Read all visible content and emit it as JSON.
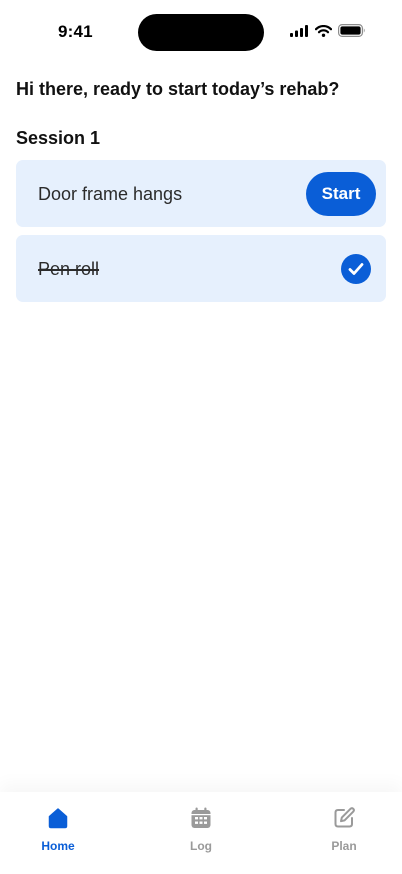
{
  "status_bar": {
    "time": "9:41"
  },
  "header": {
    "greeting": "Hi there, ready to start today’s rehab?",
    "session_title": "Session 1"
  },
  "exercises": [
    {
      "label": "Door frame hangs",
      "status": "pending",
      "action_label": "Start"
    },
    {
      "label": "Pen roll",
      "status": "completed"
    }
  ],
  "tabbar": {
    "active": "Home",
    "tabs": [
      {
        "label": "Home",
        "icon": "home-icon"
      },
      {
        "label": "Log",
        "icon": "calendar-icon"
      },
      {
        "label": "Plan",
        "icon": "edit-icon"
      }
    ]
  },
  "colors": {
    "accent": "#0a5ed7",
    "card_bg": "#e6f0fd",
    "inactive": "#9a9a9a"
  }
}
